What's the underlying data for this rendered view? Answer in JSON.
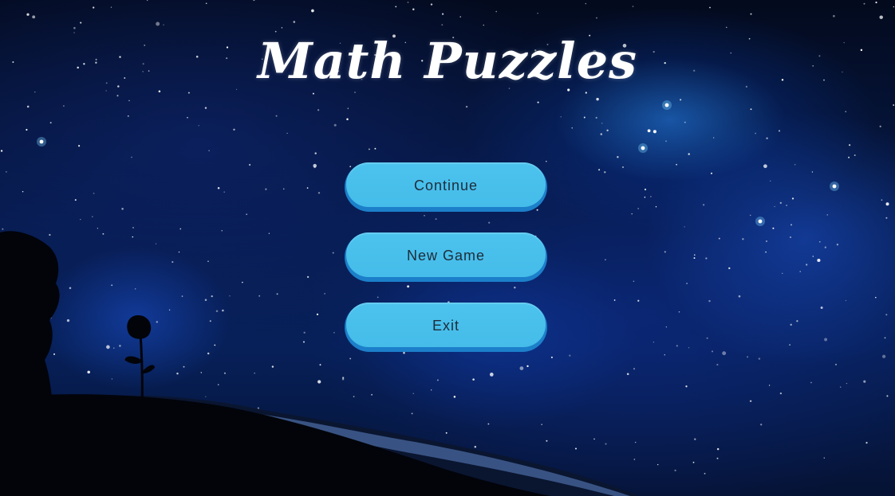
{
  "game": {
    "title": "Math Puzzles"
  },
  "menu": {
    "buttons": [
      {
        "label": "Continue"
      },
      {
        "label": "New Game"
      },
      {
        "label": "Exit"
      }
    ]
  },
  "colors": {
    "button_face": "#45bce9",
    "button_shadow": "#1c7fca",
    "button_text": "#1e2c3a",
    "title_text": "#ffffff",
    "sky_dark": "#030a1d",
    "nebula_blue": "#288cff"
  },
  "background": {
    "scene": "night-sky-with-rose-silhouette"
  }
}
